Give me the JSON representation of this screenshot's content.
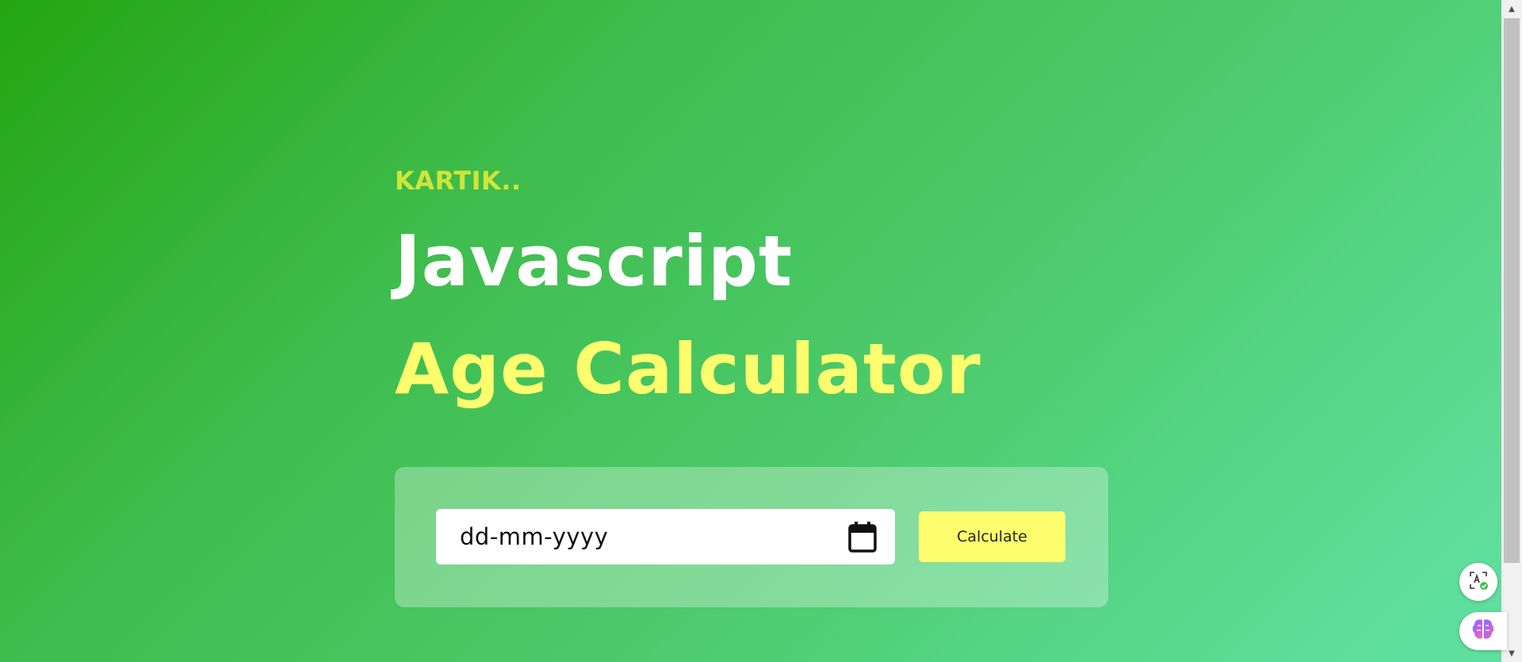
{
  "header": {
    "brand": "KARTIK..",
    "title_line1": "Javascript",
    "title_line2": "Age Calculator"
  },
  "form": {
    "date_placeholder": "dd-mm-yyyy",
    "calculate_label": "Calculate"
  },
  "icons": {
    "calendar": "calendar-icon",
    "translate": "translate-icon",
    "brain": "brain-icon"
  },
  "colors": {
    "accent_yellow": "#fdfd6e",
    "brand_yellow_green": "#cfe53a",
    "background_green_start": "#23a612",
    "background_green_end": "#60e0a0"
  }
}
